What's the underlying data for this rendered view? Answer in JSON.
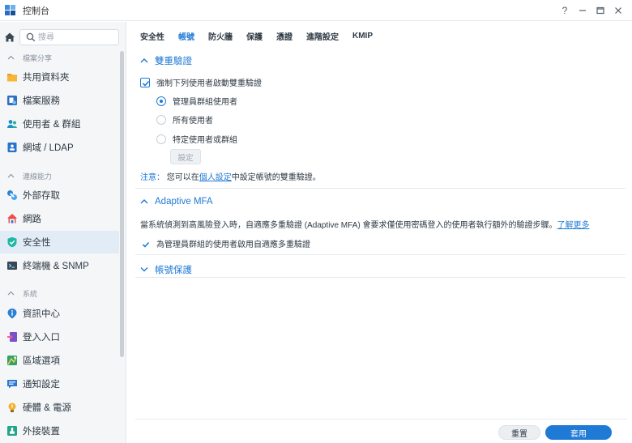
{
  "window": {
    "title": "控制台",
    "help_label": "?",
    "minimize_label": "—",
    "maximize_label": "□",
    "close_label": "✕"
  },
  "sidebar": {
    "search_placeholder": "搜尋",
    "groups": [
      {
        "label": "檔案分享"
      },
      {
        "label": "連線能力"
      },
      {
        "label": "系統"
      }
    ],
    "items": [
      {
        "label": "共用資料夾",
        "icon": "folder-icon"
      },
      {
        "label": "檔案服務",
        "icon": "file-services-icon"
      },
      {
        "label": "使用者 & 群組",
        "icon": "users-icon"
      },
      {
        "label": "網域 / LDAP",
        "icon": "domain-icon"
      },
      {
        "label": "外部存取",
        "icon": "external-access-icon"
      },
      {
        "label": "網路",
        "icon": "network-icon"
      },
      {
        "label": "安全性",
        "icon": "shield-icon",
        "active": true
      },
      {
        "label": "終端機 & SNMP",
        "icon": "terminal-icon"
      },
      {
        "label": "資訊中心",
        "icon": "info-icon"
      },
      {
        "label": "登入入口",
        "icon": "login-portal-icon"
      },
      {
        "label": "區域選項",
        "icon": "regional-icon"
      },
      {
        "label": "通知設定",
        "icon": "notification-icon"
      },
      {
        "label": "硬體 & 電源",
        "icon": "hardware-icon"
      },
      {
        "label": "外接裝置",
        "icon": "external-device-icon"
      }
    ]
  },
  "tabs": [
    {
      "label": "安全性"
    },
    {
      "label": "帳號",
      "active": true
    },
    {
      "label": "防火牆"
    },
    {
      "label": "保護"
    },
    {
      "label": "憑證"
    },
    {
      "label": "進階設定"
    },
    {
      "label": "KMIP"
    }
  ],
  "two_factor": {
    "title": "雙重驗證",
    "enforce_label": "強制下列使用者啟動雙重驗證",
    "enforce_checked": true,
    "options": [
      {
        "label": "管理員群組使用者",
        "selected": true
      },
      {
        "label": "所有使用者",
        "selected": false
      },
      {
        "label": "特定使用者或群組",
        "selected": false
      }
    ],
    "settings_button": "設定",
    "note_prefix": "注意：",
    "note_text_1": "您可以在",
    "note_link": "個人設定",
    "note_text_2": "中設定帳號的雙重驗證。"
  },
  "adaptive_mfa": {
    "title": "Adaptive MFA",
    "description": "當系統偵測到高風險登入時，自適應多重驗證 (Adaptive MFA) 會要求僅使用密碼登入的使用者執行額外的驗證步驟。",
    "learn_more": "了解更多",
    "enable_label": "為管理員群組的使用者啟用自適應多重驗證",
    "enable_checked": true
  },
  "account_protection": {
    "title": "帳號保護"
  },
  "footer": {
    "reset_label": "重置",
    "apply_label": "套用"
  },
  "colors": {
    "accent": "#1f7ad6",
    "sidebar_bg": "#f4f6f8",
    "active_item_bg": "#e1ecf7"
  }
}
